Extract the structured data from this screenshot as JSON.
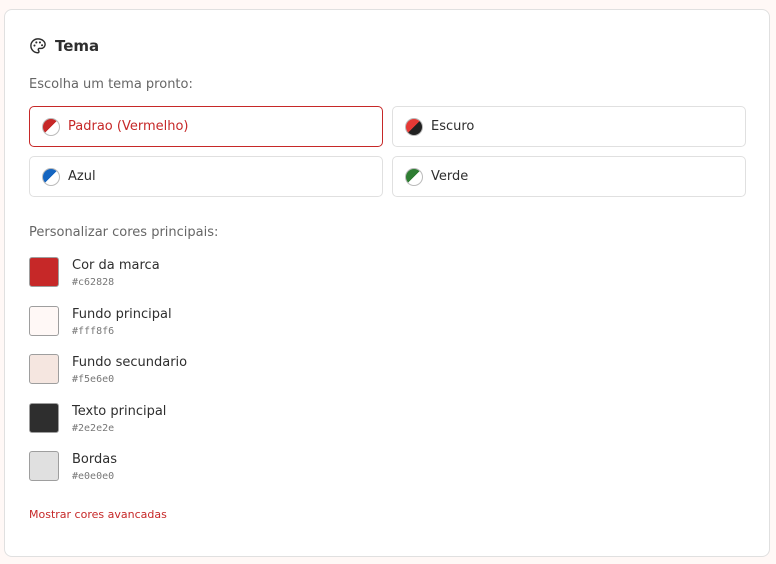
{
  "section": {
    "title": "Tema",
    "title_icon": "palette-icon"
  },
  "presets": {
    "label": "Escolha um tema pronto:",
    "items": [
      {
        "label": "Padrao (Vermelho)",
        "color_a": "#c62828",
        "color_b": "#ffffff",
        "selected": true
      },
      {
        "label": "Escuro",
        "color_a": "#e53935",
        "color_b": "#212121",
        "selected": false
      },
      {
        "label": "Azul",
        "color_a": "#1565c0",
        "color_b": "#ffffff",
        "selected": false
      },
      {
        "label": "Verde",
        "color_a": "#2e7d32",
        "color_b": "#ffffff",
        "selected": false
      }
    ]
  },
  "custom": {
    "label": "Personalizar cores principais:",
    "colors": [
      {
        "name": "Cor da marca",
        "hex": "#c62828"
      },
      {
        "name": "Fundo principal",
        "hex": "#fff8f6"
      },
      {
        "name": "Fundo secundario",
        "hex": "#f5e6e0"
      },
      {
        "name": "Texto principal",
        "hex": "#2e2e2e"
      },
      {
        "name": "Bordas",
        "hex": "#e0e0e0"
      }
    ]
  },
  "advanced_link": "Mostrar cores avancadas"
}
